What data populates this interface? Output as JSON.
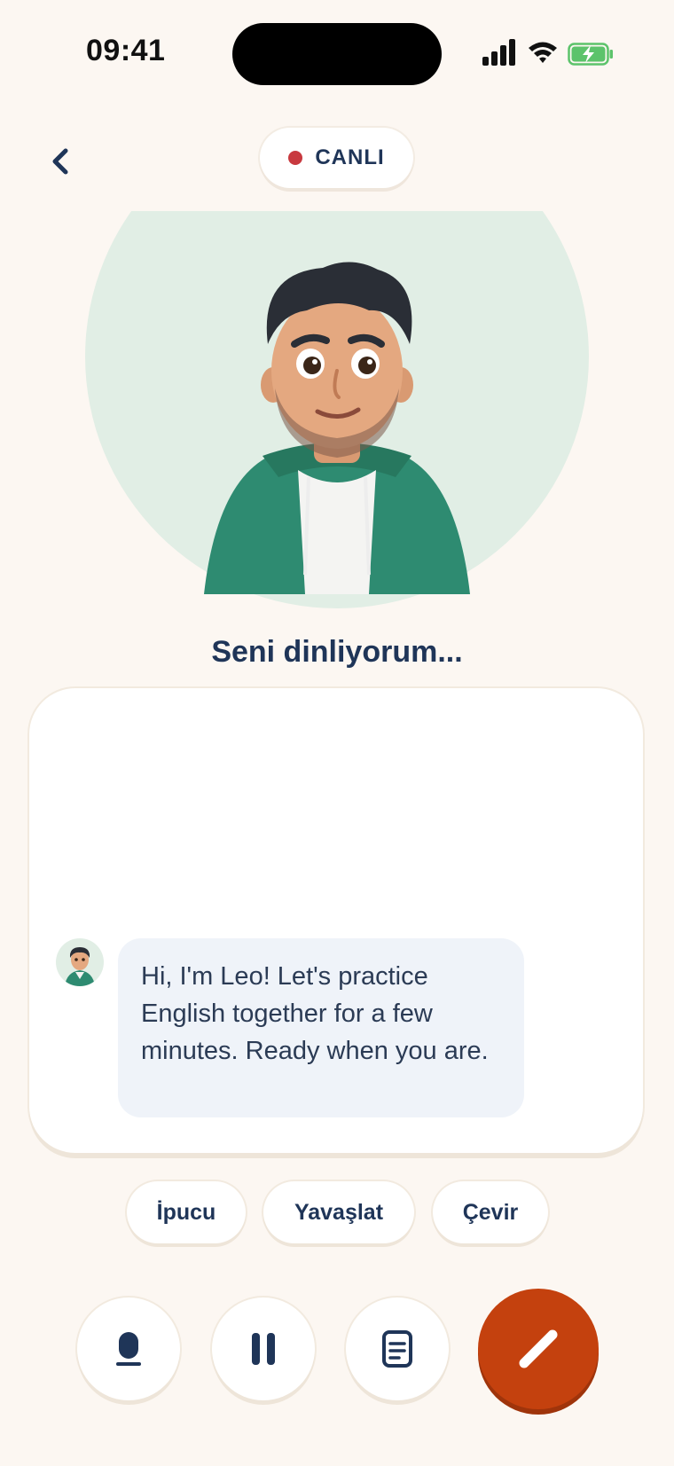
{
  "status_bar": {
    "time": "09:41"
  },
  "header": {
    "live_label": "CANLI"
  },
  "colors": {
    "background": "#FCF7F2",
    "navy": "#1F3558",
    "live_dot": "#C8393F",
    "primary": "#C4410E",
    "avatar_bg": "#E1EEE5",
    "bubble_bg": "#EFF3F9"
  },
  "status_text": "Seni dinliyorum...",
  "chat": {
    "messages": [
      {
        "sender_avatar": "leo-avatar",
        "text": "Hi, I'm Leo! Let's practice English together for a few minutes. Ready when you are."
      }
    ]
  },
  "quick_actions": [
    {
      "label": "İpucu"
    },
    {
      "label": "Yavaşlat"
    },
    {
      "label": "Çevir"
    }
  ],
  "controls": {
    "mic_icon": "microphone-icon",
    "pause_icon": "pause-icon",
    "transcript_icon": "document-icon",
    "write_icon": "pencil-icon"
  }
}
